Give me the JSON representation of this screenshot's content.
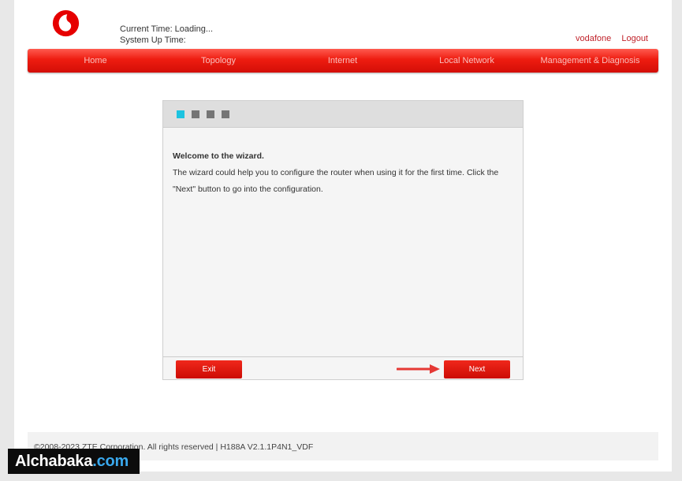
{
  "header": {
    "current_time": "Current Time: Loading...",
    "up_time": "System Up Time:",
    "user": "vodafone",
    "logout": "Logout"
  },
  "nav": {
    "items": [
      "Home",
      "Topology",
      "Internet",
      "Local Network",
      "Management & Diagnosis"
    ]
  },
  "wizard": {
    "steps": [
      "active",
      "inactive",
      "inactive",
      "inactive"
    ],
    "title": "Welcome to the wizard.",
    "text": "The wizard could help you to configure the router when using it for the first time. Click the \"Next\" button to go into the configuration.",
    "exit_label": "Exit",
    "next_label": "Next"
  },
  "footer": {
    "copyright": "©2008-2023 ZTE Corporation. All rights reserved  |   H188A V2.1.1P4N1_VDF"
  },
  "watermark": {
    "name": "Alchabaka",
    "tld": ".com"
  },
  "colors": {
    "brand_red": "#e60000",
    "step_active": "#1cc3e0",
    "step_inactive": "#757575"
  }
}
